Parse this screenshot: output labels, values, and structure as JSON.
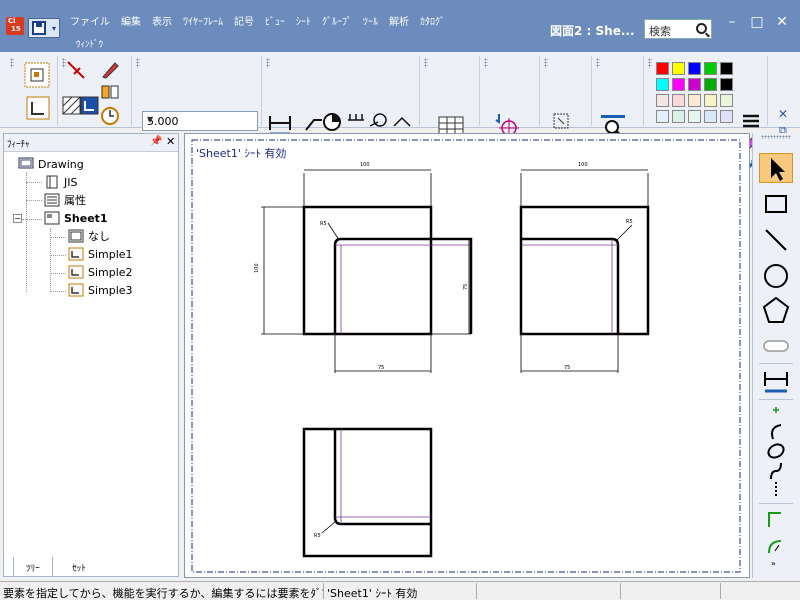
{
  "app": {
    "icon_text": "Ci",
    "icon_version": "15",
    "document_title": "図面2 : She..."
  },
  "menu": {
    "items": [
      "ファイル",
      "編集",
      "表示",
      "ﾜｲﾔｰﾌﾚｰﾑ",
      "記号",
      "ﾋﾞｭｰ",
      "ｼｰﾄ",
      "ｸﾞﾙｰﾌﾟ",
      "ﾂｰﾙ",
      "解析",
      "ｶﾀﾛｸﾞ"
    ],
    "row2": "ｳｨﾝﾄﾞｳ"
  },
  "search": {
    "placeholder": "検索"
  },
  "window_controls": {
    "minimize": "–",
    "maximize": "□",
    "close": "✕"
  },
  "toolbar": {
    "scale_value": "5.000",
    "font_icon": "F"
  },
  "palette": {
    "row1": [
      "#ff0000",
      "#ffff00",
      "#0000ff",
      "#00cc00",
      "#000000"
    ],
    "row2": [
      "#00ffff",
      "#ff00ff",
      "#cc00cc",
      "#00aa00",
      "#000000"
    ],
    "row3": [
      "#f5e4e4",
      "#f8d8d8",
      "#fbe9d0",
      "#f9f3c8",
      "#e9f5d8"
    ],
    "row4": [
      "#e2eef8",
      "#d9f0e8",
      "#e8f5f0",
      "#d8e8f8",
      "#e0e0f8"
    ]
  },
  "feature_panel": {
    "title": "ﾌｨｰﾁｬ",
    "pin": "ᵖ",
    "close": "✕",
    "tree": [
      {
        "label": "Drawing",
        "bold": false
      },
      {
        "label": "JIS",
        "bold": false
      },
      {
        "label": "属性",
        "bold": false
      },
      {
        "label": "Sheet1",
        "bold": true
      },
      {
        "label": "なし",
        "bold": false
      },
      {
        "label": "Simple1",
        "bold": false
      },
      {
        "label": "Simple2",
        "bold": false
      },
      {
        "label": "Simple3",
        "bold": false
      }
    ],
    "tabs": [
      "ﾂﾘｰ",
      "ｾｯﾄ"
    ]
  },
  "canvas": {
    "sheet_label": "'Sheet1' ｼｰﾄ 有効",
    "dims": {
      "d100": "100",
      "d75": "75",
      "r": "R5"
    }
  },
  "status": {
    "message": "要素を指定してから、機能を実行するか、編集するには要素をﾀﾞﾌﾞﾙｸﾘｯｸしてください",
    "sheet": "'Sheet1' ｼｰﾄ 有効"
  }
}
